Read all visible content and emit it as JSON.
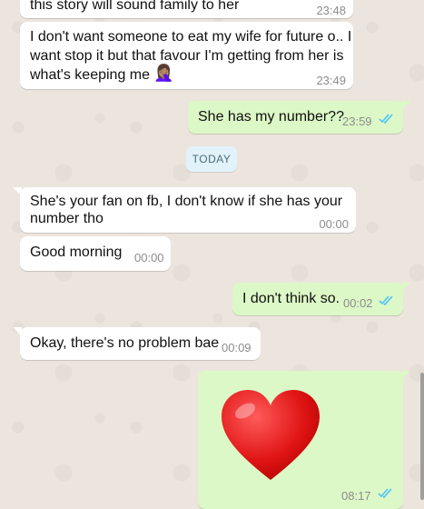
{
  "colors": {
    "incoming_bubble": "#ffffff",
    "outgoing_bubble": "#dcf8c6",
    "read_ticks": "#4fc3f7",
    "date_chip": "#e1f2fb"
  },
  "messages": [
    {
      "direction": "in",
      "lines": [
        "this story will sound family to her"
      ],
      "time": "23:48"
    },
    {
      "direction": "in",
      "lines": [
        "I don't want someone to eat my wife for future o.. I",
        "want stop it but that favour I'm getting from her is",
        "what's keeping me"
      ],
      "emoji": "🤦🏽‍♀️",
      "time": "23:49"
    },
    {
      "direction": "out",
      "lines": [
        "She has my number??"
      ],
      "time": "23:59",
      "status": "read"
    },
    {
      "direction": "in",
      "lines": [
        "She's your fan on fb, I don't know if she has your",
        "number tho"
      ],
      "time": "00:00"
    },
    {
      "direction": "in",
      "lines": [
        "Good morning"
      ],
      "time": "00:00"
    },
    {
      "direction": "out",
      "lines": [
        "I don't think so."
      ],
      "time": "00:02",
      "status": "read"
    },
    {
      "direction": "in",
      "lines": [
        "Okay, there's no problem bae"
      ],
      "time": "00:09"
    },
    {
      "direction": "out",
      "emoji": "❤️",
      "time": "08:17",
      "status": "read"
    }
  ],
  "date_separator": "TODAY"
}
